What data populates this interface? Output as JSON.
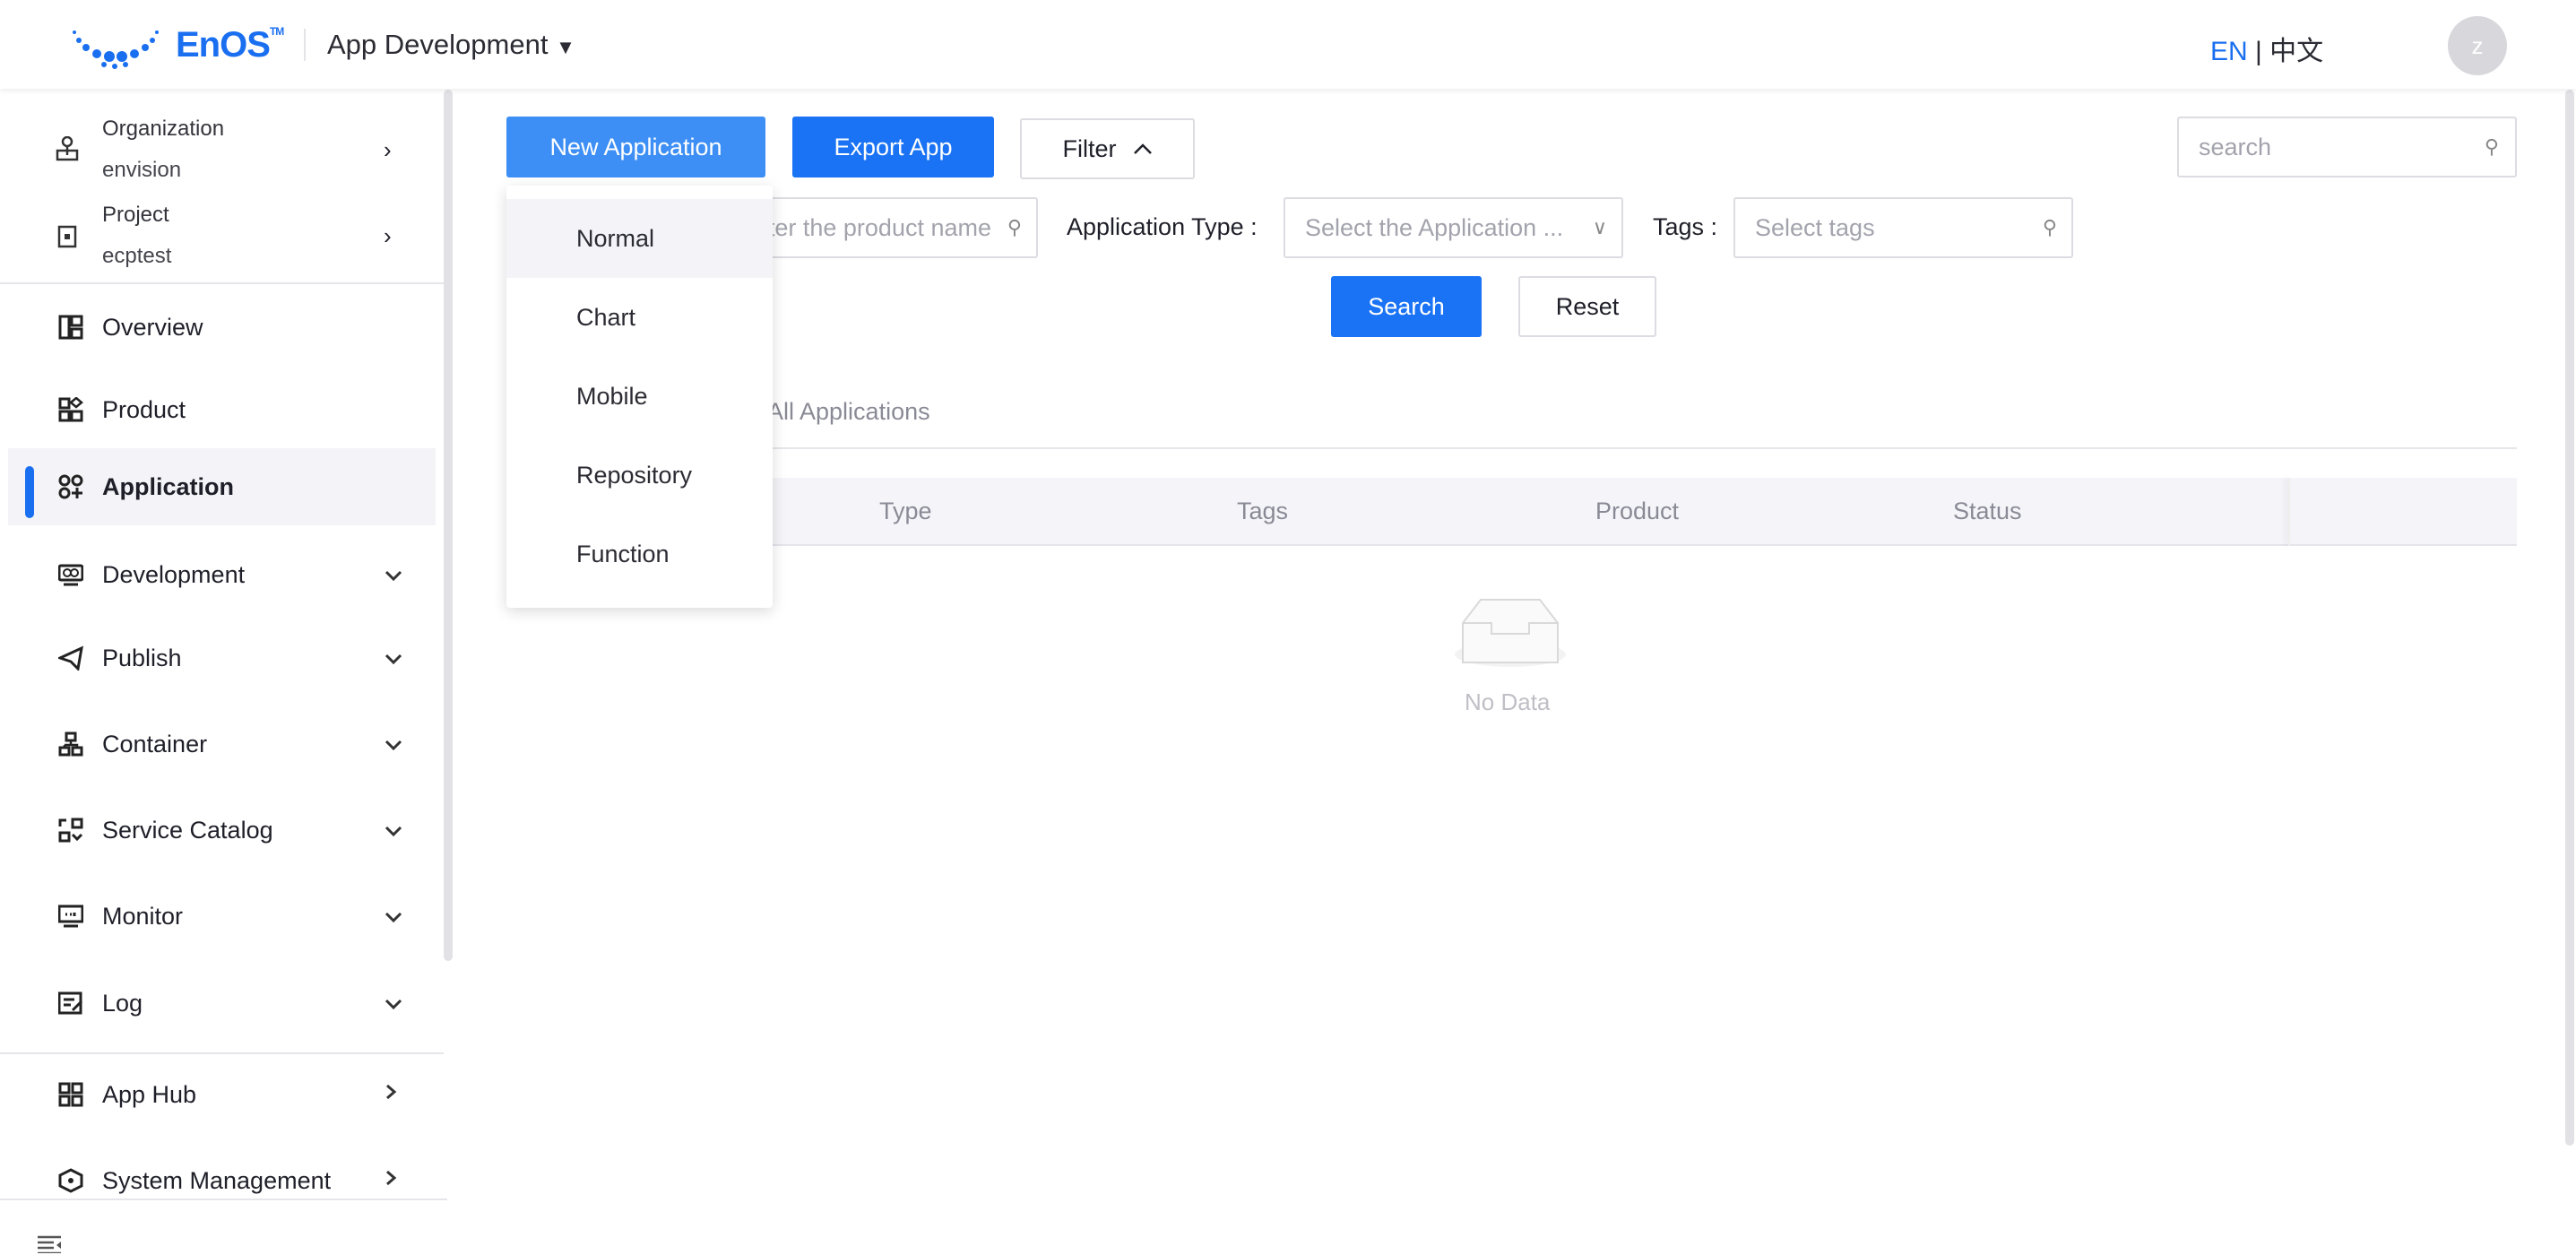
{
  "header": {
    "brand": "EnOS",
    "brand_tm": "TM",
    "app_switcher": "App Development",
    "lang_en": "EN",
    "lang_sep": "|",
    "lang_zh": "中文",
    "avatar_initial": "z"
  },
  "sidebar": {
    "organization": {
      "label": "Organization",
      "value": "envision"
    },
    "project": {
      "label": "Project",
      "value": "ecptest"
    },
    "items": [
      {
        "label": "Overview",
        "icon": "overview-icon"
      },
      {
        "label": "Product",
        "icon": "product-icon"
      },
      {
        "label": "Application",
        "icon": "application-icon",
        "active": true
      },
      {
        "label": "Development",
        "icon": "development-icon"
      },
      {
        "label": "Publish",
        "icon": "publish-icon"
      },
      {
        "label": "Container",
        "icon": "container-icon"
      },
      {
        "label": "Service Catalog",
        "icon": "service-catalog-icon"
      },
      {
        "label": "Monitor",
        "icon": "monitor-icon"
      },
      {
        "label": "Log",
        "icon": "log-icon"
      },
      {
        "label": "App Hub",
        "icon": "app-hub-icon"
      },
      {
        "label": "System Management",
        "icon": "system-management-icon"
      }
    ]
  },
  "toolbar": {
    "new_application": "New Application",
    "export_app": "Export App",
    "filter": "Filter",
    "search_placeholder": "search"
  },
  "new_app_menu": [
    "Normal",
    "Chart",
    "Mobile",
    "Repository",
    "Function"
  ],
  "filters": {
    "product_placeholder": "Enter the product name",
    "app_type_label": "Application Type :",
    "app_type_placeholder": "Select the Application ...",
    "tags_label": "Tags :",
    "tags_placeholder": "Select tags",
    "search": "Search",
    "reset": "Reset"
  },
  "tabs": [
    "All Applications"
  ],
  "table": {
    "columns": [
      "Type",
      "Tags",
      "Product",
      "Status"
    ],
    "empty": "No Data"
  },
  "colors": {
    "primary": "#1a73f5",
    "active_bg": "#f4f4f8"
  }
}
